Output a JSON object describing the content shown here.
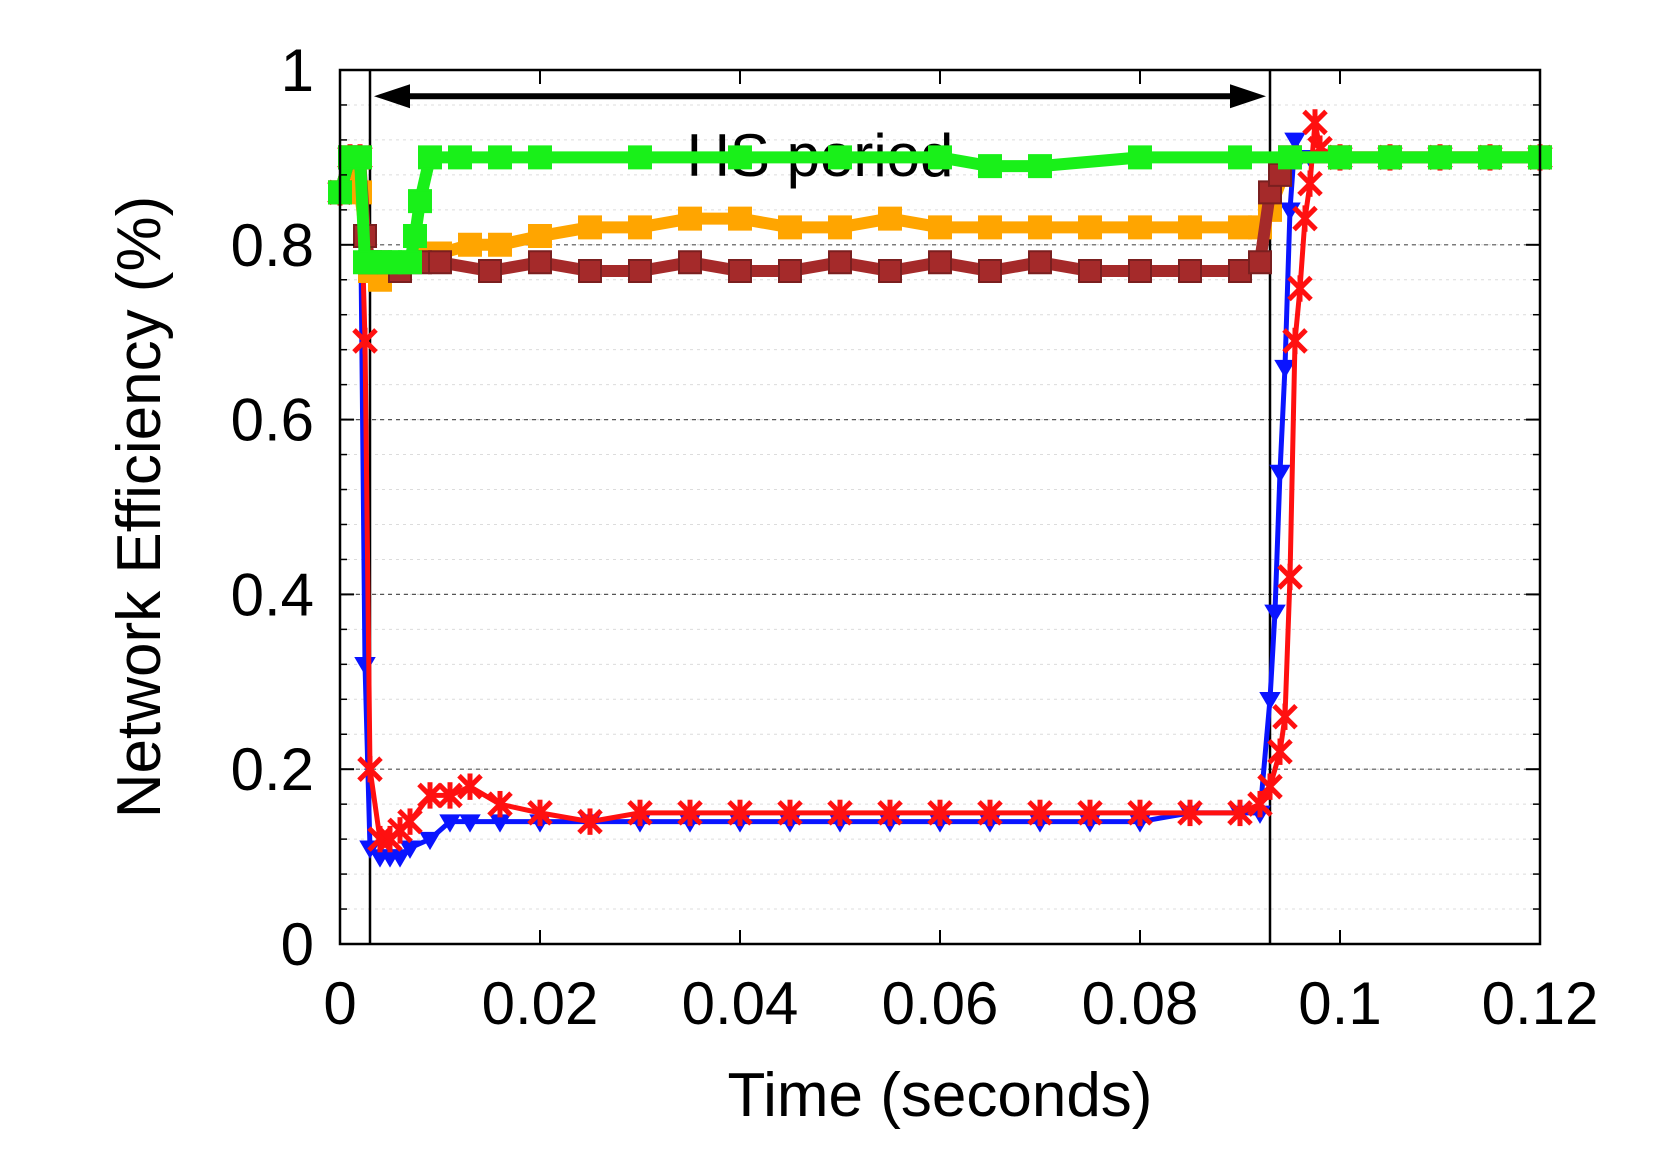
{
  "chart_data": {
    "type": "line",
    "title": "",
    "xlabel": "Time (seconds)",
    "ylabel": "Network Efficiency (%)",
    "xlim": [
      0,
      0.12
    ],
    "ylim": [
      0,
      1
    ],
    "xticks": [
      0,
      0.02,
      0.04,
      0.06,
      0.08,
      0.1,
      0.12
    ],
    "xtick_labels": [
      "0",
      "0.02",
      "0.04",
      "0.06",
      "0.08",
      "0.1",
      "0.12"
    ],
    "yticks": [
      0,
      0.2,
      0.4,
      0.6,
      0.8,
      1
    ],
    "ytick_labels": [
      "0",
      "0.2",
      "0.4",
      "0.6",
      "0.8",
      "1"
    ],
    "grid": true,
    "legend": "none",
    "annotations": {
      "hs_period": {
        "text": "HS period",
        "x_start": 0.003,
        "x_end": 0.093,
        "y": 0.97
      }
    },
    "colors": {
      "blue": "#0a14ff",
      "red": "#ff1010",
      "orange": "#ffa500",
      "brown": "#a52a2a",
      "green": "#19f019"
    },
    "series": [
      {
        "color": "blue",
        "marker": "triangle-down",
        "x": [
          0.0,
          0.001,
          0.002,
          0.0025,
          0.003,
          0.004,
          0.005,
          0.006,
          0.007,
          0.009,
          0.011,
          0.013,
          0.016,
          0.02,
          0.025,
          0.03,
          0.035,
          0.04,
          0.045,
          0.05,
          0.055,
          0.06,
          0.065,
          0.07,
          0.075,
          0.08,
          0.085,
          0.09,
          0.092,
          0.093,
          0.0935,
          0.094,
          0.0945,
          0.095,
          0.0955,
          0.096,
          0.097,
          0.1,
          0.105,
          0.11,
          0.115,
          0.12
        ],
        "y": [
          0.86,
          0.9,
          0.9,
          0.32,
          0.11,
          0.1,
          0.1,
          0.1,
          0.11,
          0.12,
          0.14,
          0.14,
          0.14,
          0.14,
          0.14,
          0.14,
          0.14,
          0.14,
          0.14,
          0.14,
          0.14,
          0.14,
          0.14,
          0.14,
          0.14,
          0.14,
          0.15,
          0.15,
          0.15,
          0.28,
          0.38,
          0.54,
          0.66,
          0.84,
          0.92,
          0.9,
          0.9,
          0.9,
          0.9,
          0.9,
          0.9,
          0.9
        ]
      },
      {
        "color": "red",
        "marker": "star",
        "x": [
          0.0,
          0.001,
          0.002,
          0.0025,
          0.003,
          0.004,
          0.005,
          0.006,
          0.007,
          0.009,
          0.011,
          0.013,
          0.016,
          0.02,
          0.025,
          0.03,
          0.035,
          0.04,
          0.045,
          0.05,
          0.055,
          0.06,
          0.065,
          0.07,
          0.075,
          0.08,
          0.085,
          0.09,
          0.092,
          0.093,
          0.094,
          0.0945,
          0.095,
          0.0955,
          0.096,
          0.0965,
          0.097,
          0.0975,
          0.098,
          0.1,
          0.105,
          0.11,
          0.115,
          0.12
        ],
        "y": [
          0.86,
          0.9,
          0.9,
          0.69,
          0.2,
          0.12,
          0.12,
          0.13,
          0.14,
          0.17,
          0.17,
          0.18,
          0.16,
          0.15,
          0.14,
          0.15,
          0.15,
          0.15,
          0.15,
          0.15,
          0.15,
          0.15,
          0.15,
          0.15,
          0.15,
          0.15,
          0.15,
          0.15,
          0.16,
          0.18,
          0.22,
          0.26,
          0.42,
          0.69,
          0.75,
          0.83,
          0.87,
          0.94,
          0.91,
          0.9,
          0.9,
          0.9,
          0.9,
          0.9
        ]
      },
      {
        "color": "orange",
        "marker": "square",
        "x": [
          0.0,
          0.001,
          0.002,
          0.003,
          0.004,
          0.006,
          0.008,
          0.01,
          0.013,
          0.016,
          0.02,
          0.025,
          0.03,
          0.035,
          0.04,
          0.045,
          0.05,
          0.055,
          0.06,
          0.065,
          0.07,
          0.075,
          0.08,
          0.085,
          0.09,
          0.092,
          0.093,
          0.095,
          0.1,
          0.105,
          0.11,
          0.115,
          0.12
        ],
        "y": [
          0.86,
          0.9,
          0.86,
          0.77,
          0.76,
          0.77,
          0.79,
          0.79,
          0.8,
          0.8,
          0.81,
          0.82,
          0.82,
          0.83,
          0.83,
          0.82,
          0.82,
          0.83,
          0.82,
          0.82,
          0.82,
          0.82,
          0.82,
          0.82,
          0.82,
          0.82,
          0.84,
          0.9,
          0.9,
          0.9,
          0.9,
          0.9,
          0.9
        ]
      },
      {
        "color": "brown",
        "marker": "square",
        "x": [
          0.0,
          0.001,
          0.002,
          0.0025,
          0.003,
          0.004,
          0.006,
          0.008,
          0.01,
          0.015,
          0.02,
          0.025,
          0.03,
          0.035,
          0.04,
          0.045,
          0.05,
          0.055,
          0.06,
          0.065,
          0.07,
          0.075,
          0.08,
          0.085,
          0.09,
          0.092,
          0.093,
          0.094,
          0.095,
          0.1,
          0.105,
          0.11,
          0.115,
          0.12
        ],
        "y": [
          0.86,
          0.9,
          0.9,
          0.81,
          0.78,
          0.78,
          0.77,
          0.78,
          0.78,
          0.77,
          0.78,
          0.77,
          0.77,
          0.78,
          0.77,
          0.77,
          0.78,
          0.77,
          0.78,
          0.77,
          0.78,
          0.77,
          0.77,
          0.77,
          0.77,
          0.78,
          0.86,
          0.88,
          0.9,
          0.9,
          0.9,
          0.9,
          0.9,
          0.9
        ]
      },
      {
        "color": "green",
        "marker": "square",
        "x": [
          0.0,
          0.001,
          0.002,
          0.0025,
          0.003,
          0.004,
          0.005,
          0.006,
          0.007,
          0.0075,
          0.008,
          0.009,
          0.012,
          0.016,
          0.02,
          0.03,
          0.04,
          0.05,
          0.06,
          0.065,
          0.07,
          0.08,
          0.09,
          0.095,
          0.1,
          0.105,
          0.11,
          0.115,
          0.12
        ],
        "y": [
          0.86,
          0.9,
          0.9,
          0.78,
          0.78,
          0.78,
          0.78,
          0.78,
          0.78,
          0.81,
          0.85,
          0.9,
          0.9,
          0.9,
          0.9,
          0.9,
          0.9,
          0.9,
          0.9,
          0.89,
          0.89,
          0.9,
          0.9,
          0.9,
          0.9,
          0.9,
          0.9,
          0.9,
          0.9
        ]
      }
    ]
  }
}
